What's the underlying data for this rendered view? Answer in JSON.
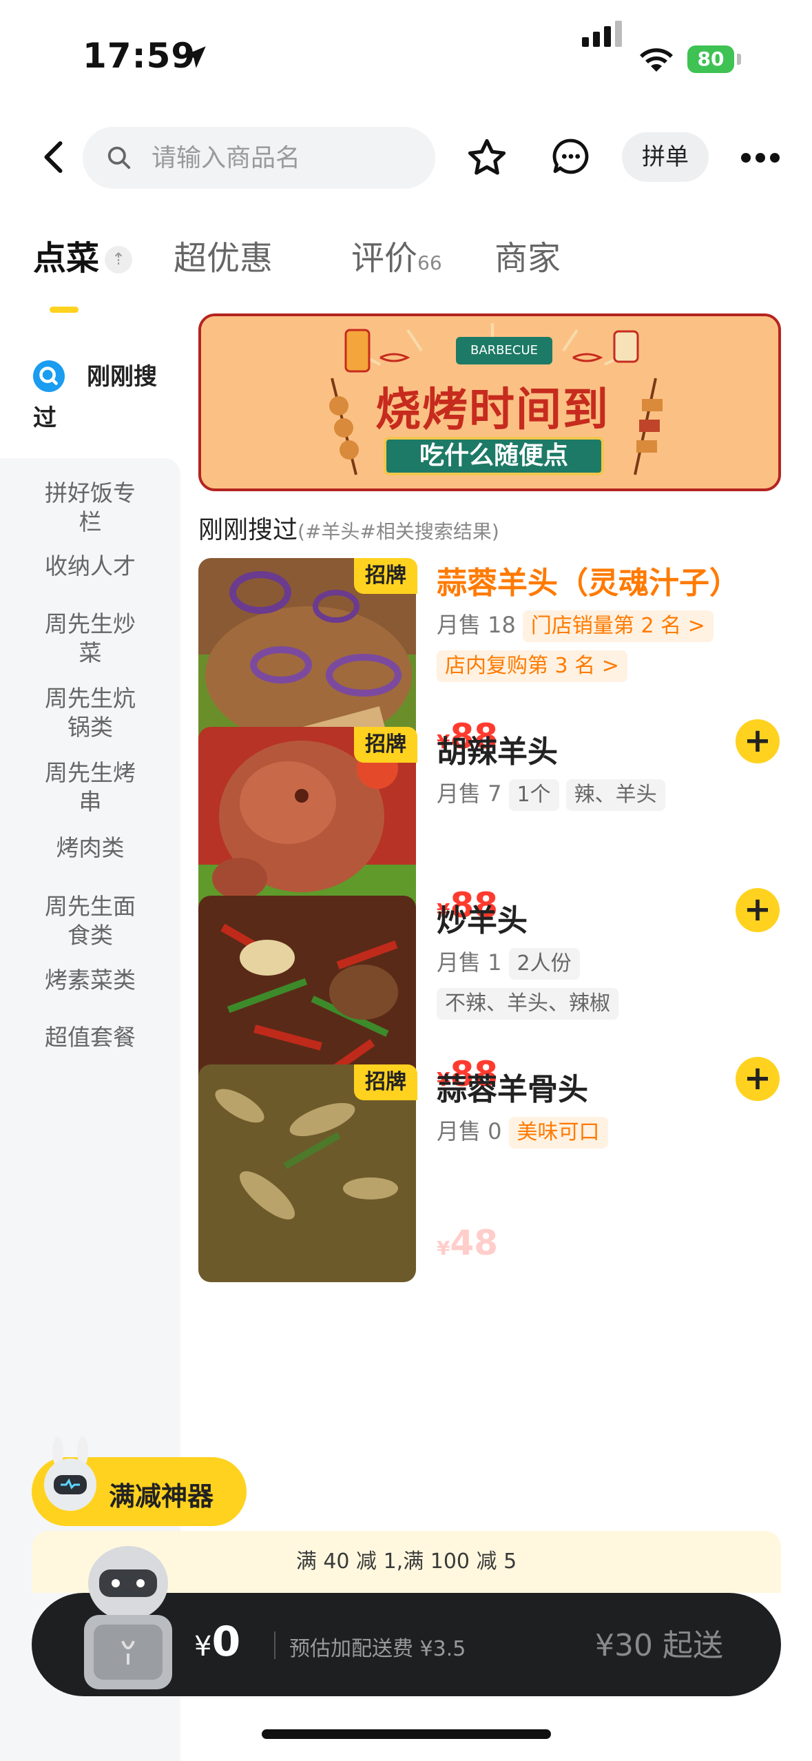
{
  "status_bar": {
    "time": "17:59",
    "battery": "80"
  },
  "header": {
    "search_placeholder": "请输入商品名",
    "pin_label": "拼单"
  },
  "tabs": [
    {
      "label": "点菜",
      "active": true
    },
    {
      "label": "超优惠"
    },
    {
      "label": "评价",
      "count": "66"
    },
    {
      "label": "商家"
    }
  ],
  "sidebar": {
    "recent_label": "刚刚搜过",
    "items": [
      {
        "label": "拼好饭专栏"
      },
      {
        "label": "收纳人才"
      },
      {
        "label": "周先生炒菜"
      },
      {
        "label": "周先生炕锅类"
      },
      {
        "label": "周先生烤串"
      },
      {
        "label": "烤肉类"
      },
      {
        "label": "周先生面食类"
      },
      {
        "label": "烤素菜类"
      },
      {
        "label": "超值套餐"
      }
    ]
  },
  "banner": {
    "title": "烧烤时间到",
    "ribbon": "BARBECUE",
    "subtitle": "吃什么随便点"
  },
  "section": {
    "title": "刚刚搜过",
    "subtitle": "(#羊头#相关搜索结果)"
  },
  "items": [
    {
      "name": "蒜蓉羊头（灵魂汁子）",
      "badge": "招牌",
      "sales": "月售 18",
      "tags_line1": [
        "门店销量第 2 名 >"
      ],
      "tags_line2": [
        "店内复购第 3 名 >"
      ],
      "price": "88",
      "highlight": true
    },
    {
      "name": "胡辣羊头",
      "badge": "招牌",
      "sales": "月售 7",
      "tags_line1": [
        "1个",
        "辣、羊头"
      ],
      "price": "88"
    },
    {
      "name": "炒羊头",
      "badge": "",
      "sales": "月售 1",
      "tags_line1": [
        "2人份"
      ],
      "tags_line2": [
        "不辣、羊头、辣椒"
      ],
      "price": "88"
    },
    {
      "name": "蒜蓉羊骨头",
      "badge": "招牌",
      "sales": "月售 0",
      "tags_line1": [
        "美味可口"
      ],
      "price": "48"
    }
  ],
  "promo": {
    "label": "满减神器",
    "discount_text": "满 40 减 1,满 100 减 5"
  },
  "cart": {
    "currency": "¥",
    "total": "0",
    "delivery_fee": "预估加配送费 ¥3.5",
    "min_order": "¥30 起送"
  },
  "colors": {
    "accent": "#ffd21f",
    "price": "#ff3b2f",
    "orange": "#ff7a00"
  }
}
